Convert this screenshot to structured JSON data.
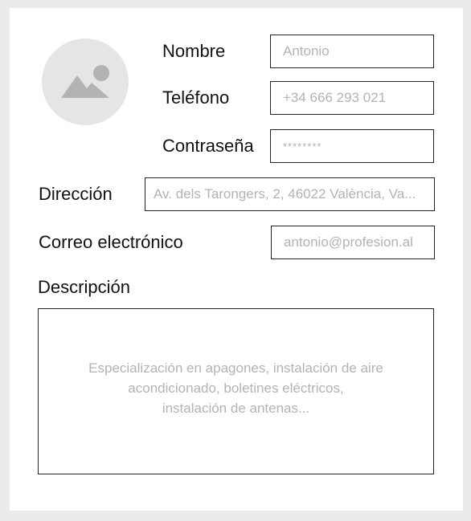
{
  "avatar": {
    "icon": "image-placeholder-icon",
    "colors": {
      "background": "#e5e5e5",
      "glyph": "#b3b3b3"
    }
  },
  "form": {
    "name": {
      "label": "Nombre",
      "placeholder": "Antonio"
    },
    "phone": {
      "label": "Teléfono",
      "placeholder": "+34 666 293 021"
    },
    "password": {
      "label": "Contraseña",
      "placeholder": "********"
    },
    "address": {
      "label": "Dirección",
      "placeholder": "Av. dels Tarongers, 2, 46022 València, Va..."
    },
    "email": {
      "label": "Correo electrónico",
      "placeholder": "antonio@profesion.al"
    },
    "description": {
      "label": "Descripción",
      "placeholder": "Especialización en apagones, instalación de aire\nacondicionado, boletines eléctricos,\ninstalación de antenas..."
    }
  }
}
